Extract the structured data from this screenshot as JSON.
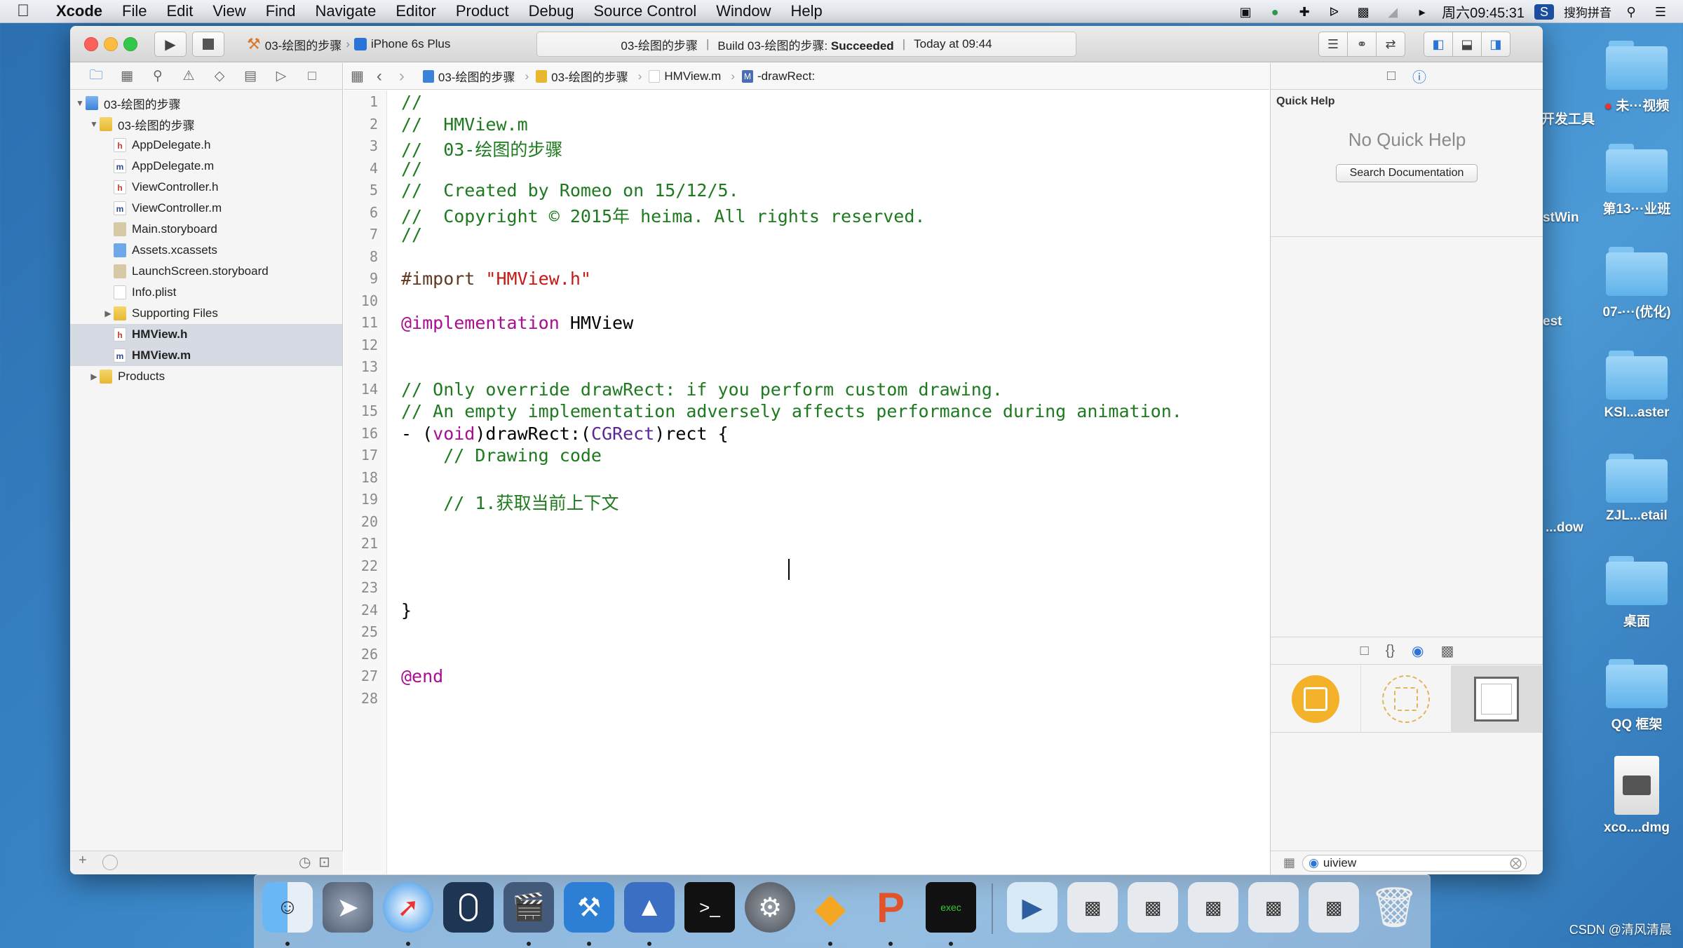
{
  "menubar": {
    "app_name": "Xcode",
    "items": [
      "File",
      "Edit",
      "View",
      "Find",
      "Navigate",
      "Editor",
      "Product",
      "Debug",
      "Source Control",
      "Window",
      "Help"
    ],
    "clock": "周六09:45:31",
    "input_method": "搜狗拼音"
  },
  "toolbar": {
    "scheme_name": "03-绘图的步骤",
    "device": "iPhone 6s Plus",
    "activity_project": "03-绘图的步骤",
    "activity_build": "Build 03-绘图的步骤:",
    "activity_status": "Succeeded",
    "activity_time": "Today at 09:44"
  },
  "navigator": {
    "items": [
      {
        "label": "03-绘图的步骤",
        "kind": "project"
      },
      {
        "label": "03-绘图的步骤",
        "kind": "folder"
      },
      {
        "label": "AppDelegate.h",
        "kind": "h"
      },
      {
        "label": "AppDelegate.m",
        "kind": "m"
      },
      {
        "label": "ViewController.h",
        "kind": "h"
      },
      {
        "label": "ViewController.m",
        "kind": "m"
      },
      {
        "label": "Main.storyboard",
        "kind": "storyboard"
      },
      {
        "label": "Assets.xcassets",
        "kind": "assets"
      },
      {
        "label": "LaunchScreen.storyboard",
        "kind": "storyboard"
      },
      {
        "label": "Info.plist",
        "kind": "plist"
      },
      {
        "label": "Supporting Files",
        "kind": "folder"
      },
      {
        "label": "HMView.h",
        "kind": "h"
      },
      {
        "label": "HMView.m",
        "kind": "m"
      },
      {
        "label": "Products",
        "kind": "folder"
      }
    ]
  },
  "jumpbar": {
    "project": "03-绘图的步骤",
    "group": "03-绘图的步骤",
    "file": "HMView.m",
    "method_badge": "M",
    "method": "-drawRect:"
  },
  "editor": {
    "line_numbers": [
      "1",
      "2",
      "3",
      "4",
      "5",
      "6",
      "7",
      "8",
      "9",
      "10",
      "11",
      "12",
      "13",
      "14",
      "15",
      "16",
      "17",
      "18",
      "19",
      "20",
      "21",
      "22",
      "23",
      "24",
      "25",
      "26",
      "27",
      "28"
    ],
    "lines": {
      "l1": "//",
      "l2": "//  HMView.m",
      "l3": "//  03-绘图的步骤",
      "l4": "//",
      "l5": "//  Created by Romeo on 15/12/5.",
      "l6": "//  Copyright © 2015年 heima. All rights reserved.",
      "l7": "//",
      "l9_kw": "#import",
      "l9_str": "\"HMView.h\"",
      "l11_kw": "@implementation",
      "l11_name": "HMView",
      "l14": "// Only override drawRect: if you perform custom drawing.",
      "l15": "// An empty implementation adversely affects performance during animation.",
      "l16_a": "- (",
      "l16_void": "void",
      "l16_b": ")drawRect:(",
      "l16_type": "CGRect",
      "l16_c": ")rect {",
      "l17": "    // Drawing code",
      "l19": "    // 1.获取当前上下文",
      "l24": "}",
      "l27": "@end"
    }
  },
  "inspector": {
    "title": "Quick Help",
    "empty_text": "No Quick Help",
    "search_button": "Search Documentation",
    "filter_value": "uiview"
  },
  "desktop": {
    "items": [
      "未···视频",
      "第13···业班",
      "07-···(优化)",
      "KSI...aster",
      "ZJL...etail",
      "桌面",
      "QQ 框架",
      "xco....dmg"
    ],
    "partials": [
      "开发工具",
      "stWin",
      "est",
      "...dow"
    ]
  },
  "watermark": "CSDN @清风清晨"
}
